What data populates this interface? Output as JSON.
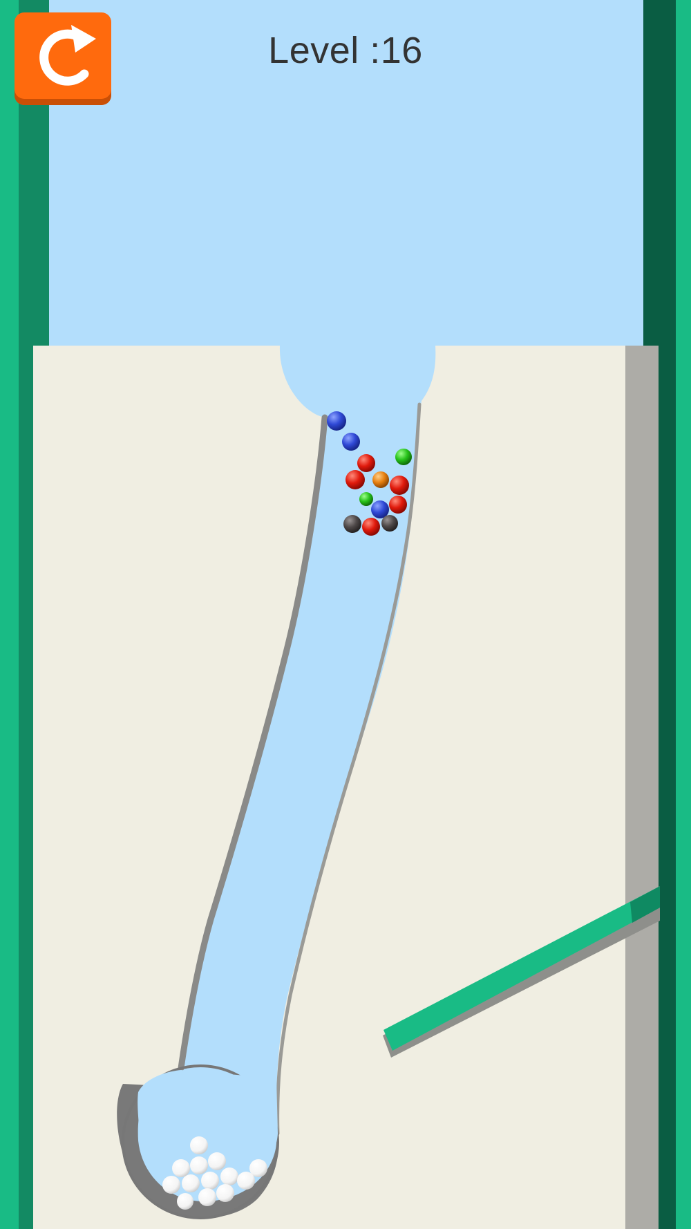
{
  "hud": {
    "level_text": "Level :16"
  },
  "restart_button": {
    "icon": "restart-arrow-icon",
    "color": "#ff6a0d"
  },
  "colors": {
    "sky": "#b3defc",
    "sand": "#f0eee2",
    "wall_green": "#19bb85",
    "wall_dark_green": "#0a5d43",
    "side_shadow": "#adaca7",
    "cup": "#797979",
    "ramp_green": "#19bb85"
  },
  "balls": {
    "colored": [
      "blue",
      "blue",
      "green",
      "red",
      "red",
      "orange",
      "red",
      "green",
      "blue",
      "red",
      "dark-gray",
      "red",
      "dark-gray"
    ],
    "collected_white_count": 13
  }
}
